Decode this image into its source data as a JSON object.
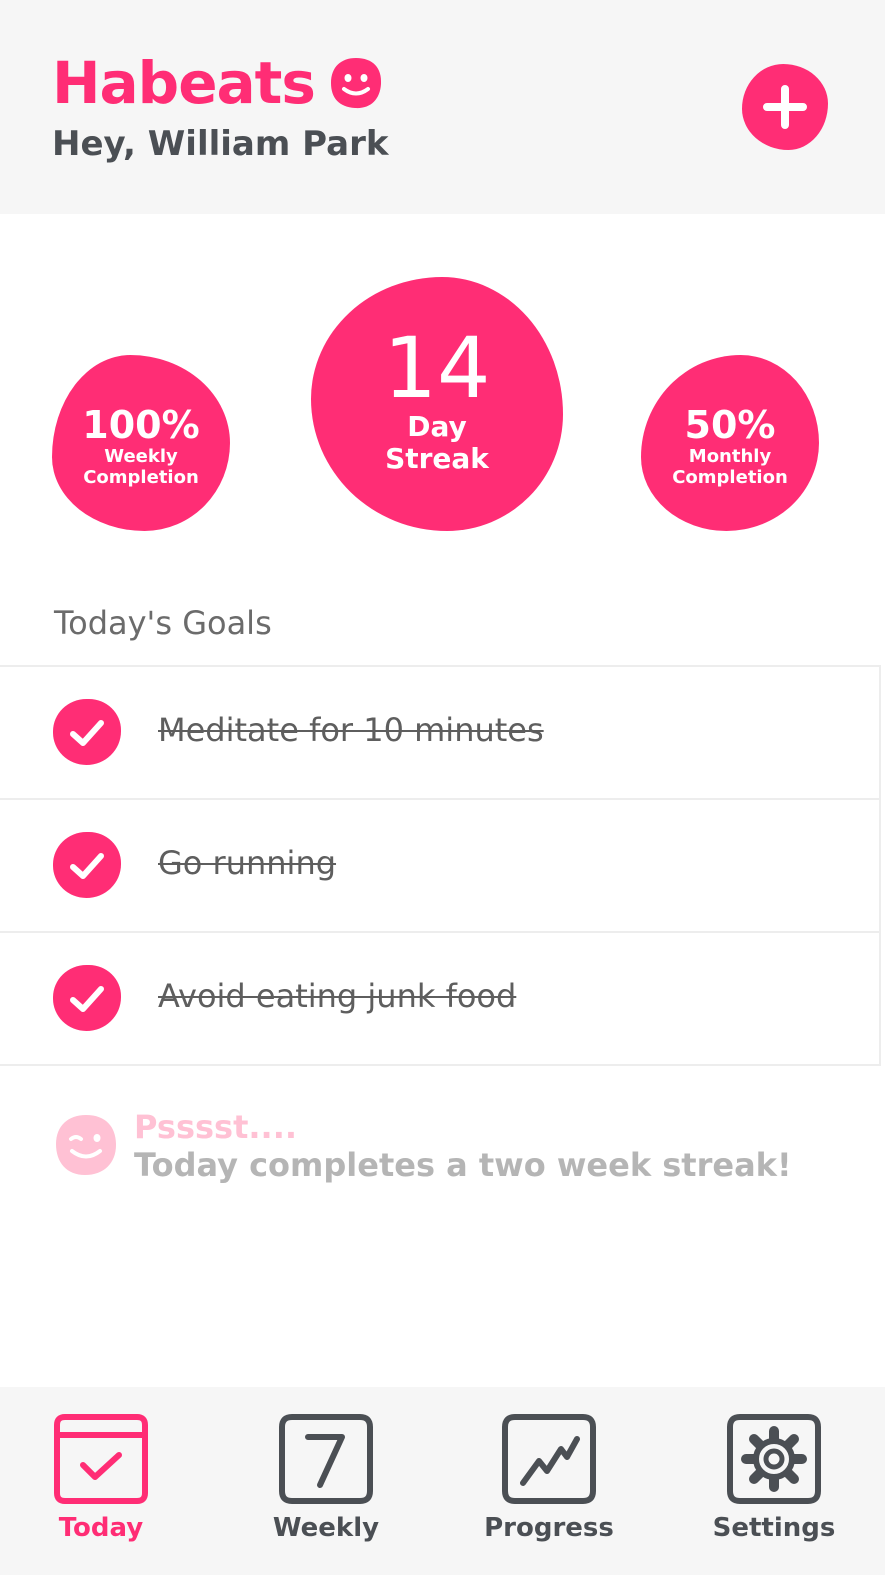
{
  "app": {
    "name": "Habeats",
    "greeting": "Hey, William Park",
    "accent_color": "#ff2d75",
    "logo_icon": "smiley-icon",
    "add_icon": "plus-icon"
  },
  "stats": {
    "weekly": {
      "value": "100%",
      "label": "Weekly Completion"
    },
    "streak": {
      "value": "14",
      "label_line1": "Day",
      "label_line2": "Streak"
    },
    "monthly": {
      "value": "50%",
      "label": "Monthly Completion"
    }
  },
  "goals": {
    "title": "Today's Goals",
    "items": [
      {
        "label": "Meditate for 10 minutes",
        "completed": true,
        "icon": "check-icon"
      },
      {
        "label": "Go running",
        "completed": true,
        "icon": "check-icon"
      },
      {
        "label": "Avoid eating junk food",
        "completed": true,
        "icon": "check-icon"
      }
    ]
  },
  "tip": {
    "title": "Psssst....",
    "text": "Today completes a two week streak!",
    "icon": "winking-face-icon"
  },
  "nav": {
    "items": [
      {
        "label": "Today",
        "icon": "calendar-check-icon",
        "active": true
      },
      {
        "label": "Weekly",
        "icon": "seven-icon",
        "active": false
      },
      {
        "label": "Progress",
        "icon": "trend-chart-icon",
        "active": false
      },
      {
        "label": "Settings",
        "icon": "gear-icon",
        "active": false
      }
    ]
  }
}
